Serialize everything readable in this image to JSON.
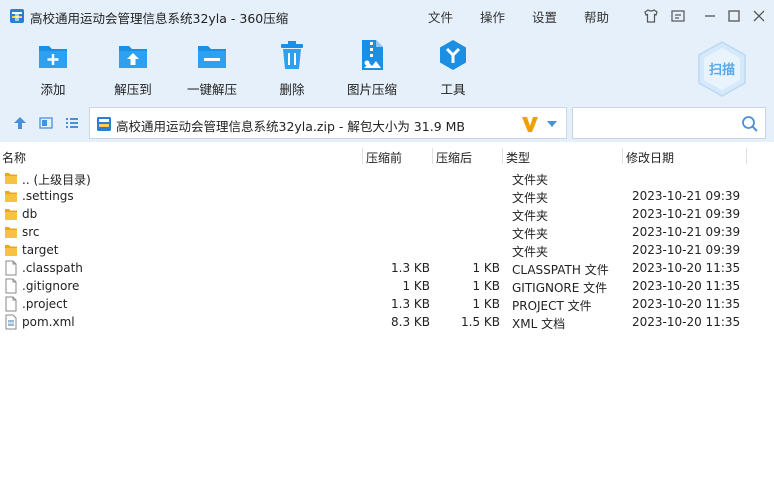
{
  "window": {
    "title": "高校通用运动会管理信息系统32yla - 360压缩",
    "menu": [
      "文件",
      "操作",
      "设置",
      "帮助"
    ]
  },
  "toolbar": {
    "buttons": [
      {
        "label": "添加",
        "icon": "add-icon"
      },
      {
        "label": "解压到",
        "icon": "extract-to-icon"
      },
      {
        "label": "一键解压",
        "icon": "one-click-extract-icon"
      },
      {
        "label": "删除",
        "icon": "delete-icon"
      },
      {
        "label": "图片压缩",
        "icon": "image-compress-icon"
      },
      {
        "label": "工具",
        "icon": "tools-icon"
      }
    ],
    "scan_label": "扫描"
  },
  "address": {
    "path": "高校通用运动会管理信息系统32yla.zip - 解包大小为 31.9 MB",
    "search_placeholder": ""
  },
  "columns": {
    "name": "名称",
    "size": "压缩前",
    "packed": "压缩后",
    "type": "类型",
    "date": "修改日期"
  },
  "files": [
    {
      "name": ".. (上级目录)",
      "size": "",
      "packed": "",
      "type": "文件夹",
      "date": "",
      "kind": "folder"
    },
    {
      "name": ".settings",
      "size": "",
      "packed": "",
      "type": "文件夹",
      "date": "2023-10-21 09:39",
      "kind": "folder"
    },
    {
      "name": "db",
      "size": "",
      "packed": "",
      "type": "文件夹",
      "date": "2023-10-21 09:39",
      "kind": "folder"
    },
    {
      "name": "src",
      "size": "",
      "packed": "",
      "type": "文件夹",
      "date": "2023-10-21 09:39",
      "kind": "folder"
    },
    {
      "name": "target",
      "size": "",
      "packed": "",
      "type": "文件夹",
      "date": "2023-10-21 09:39",
      "kind": "folder"
    },
    {
      "name": ".classpath",
      "size": "1.3 KB",
      "packed": "1 KB",
      "type": "CLASSPATH 文件",
      "date": "2023-10-20 11:35",
      "kind": "file"
    },
    {
      "name": ".gitignore",
      "size": "1 KB",
      "packed": "1 KB",
      "type": "GITIGNORE 文件",
      "date": "2023-10-20 11:35",
      "kind": "file"
    },
    {
      "name": ".project",
      "size": "1.3 KB",
      "packed": "1 KB",
      "type": "PROJECT 文件",
      "date": "2023-10-20 11:35",
      "kind": "file"
    },
    {
      "name": "pom.xml",
      "size": "8.3 KB",
      "packed": "1.5 KB",
      "type": "XML 文档",
      "date": "2023-10-20 11:35",
      "kind": "xml"
    }
  ],
  "colors": {
    "chrome": "#e6f0fb",
    "accent": "#1a8fe3",
    "folder": "#f5c242",
    "v_logo": "#f0a000"
  }
}
